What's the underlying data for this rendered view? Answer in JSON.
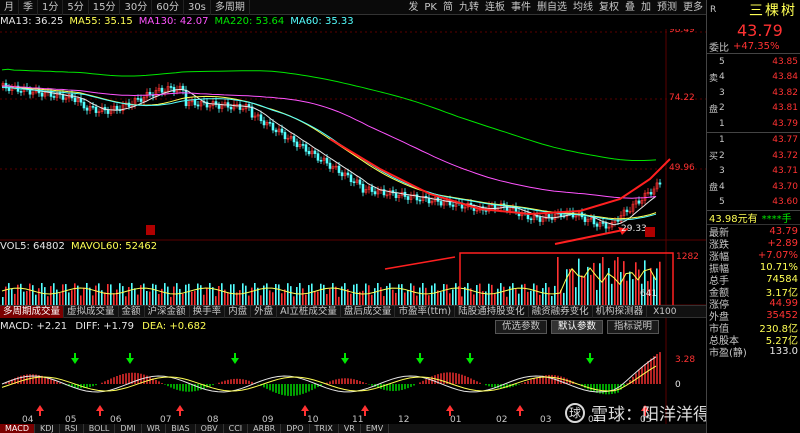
{
  "toolbar": {
    "periods": [
      "月",
      "季",
      "1分",
      "5分",
      "15分",
      "30分",
      "60分",
      "30s",
      "多周期"
    ],
    "tools": [
      "发",
      "PK",
      "简",
      "九转",
      "连板",
      "事件",
      "删自选",
      "均线",
      "复权",
      "叠",
      "加",
      "预测",
      "更多"
    ]
  },
  "ma_legend": [
    {
      "label": "MA13: 36.25",
      "color": "#e6e6e6"
    },
    {
      "label": "MA55: 35.15",
      "color": "#ffff54"
    },
    {
      "label": "MA130: 42.07",
      "color": "#ff54ff"
    },
    {
      "label": "MA220: 53.64",
      "color": "#00e600"
    },
    {
      "label": "MA60: 35.33",
      "color": "#54ffff"
    }
  ],
  "price_axis": [
    "98.49",
    "74.22",
    "49.96"
  ],
  "annotations": {
    "low_price": "29.33"
  },
  "vol_legend": {
    "vol5": "VOL5: 64802",
    "mavol60": "MAVOL60: 52462"
  },
  "vol_axis": [
    "1282",
    "641",
    "X100"
  ],
  "tabs": [
    "多周期成交量",
    "虚拟成交量",
    "金额",
    "沪深金额",
    "换手率",
    "内盘",
    "外盘",
    "AI立桩成交量",
    "盘后成交量",
    "市盈率(ttm)",
    "陆股通持股变化",
    "融资融券变化",
    "机构探测器"
  ],
  "buttons": [
    "优选参数",
    "默认参数",
    "指标说明"
  ],
  "macd_legend": {
    "macd": "MACD: +2.21",
    "diff": "DIFF: +1.79",
    "dea": "DEA: +0.682"
  },
  "macd_axis": [
    "3.28",
    "0"
  ],
  "x_axis": [
    "04",
    "05",
    "06",
    "07",
    "08",
    "09",
    "10",
    "11",
    "12",
    "01",
    "02",
    "03",
    "04",
    "05"
  ],
  "bottom_tabs": [
    "MACD",
    "KDJ",
    "RSI",
    "BOLL",
    "DMI",
    "WR",
    "BIAS",
    "OBV",
    "CCI",
    "ARBR",
    "DPO",
    "TRIX",
    "VR",
    "EMV"
  ],
  "quote": {
    "code": "R",
    "name": "三棵树",
    "price": "43.79",
    "ratio_label": "委比",
    "ratio_value": "+47.35%",
    "sell": [
      {
        "lvl": "5",
        "price": "43.85"
      },
      {
        "lvl": "4",
        "price": "43.84"
      },
      {
        "lvl": "3",
        "price": "43.82"
      },
      {
        "lvl": "2",
        "price": "43.81"
      },
      {
        "lvl": "1",
        "price": "43.79"
      }
    ],
    "sell_labels": [
      "卖",
      "盘"
    ],
    "buy": [
      {
        "lvl": "1",
        "price": "43.77"
      },
      {
        "lvl": "2",
        "price": "43.72"
      },
      {
        "lvl": "3",
        "price": "43.71"
      },
      {
        "lvl": "4",
        "price": "43.70"
      },
      {
        "lvl": "5",
        "price": "43.60"
      }
    ],
    "buy_labels": [
      "买",
      "盘"
    ],
    "info_a": "43.98元有",
    "info_b": "****手",
    "stats": [
      {
        "k": "最新",
        "v": "43.79",
        "c": "up"
      },
      {
        "k": "涨跌",
        "v": "+2.89",
        "c": "up"
      },
      {
        "k": "涨幅",
        "v": "+7.07%",
        "c": "up"
      },
      {
        "k": "振幅",
        "v": "10.71%",
        "c": "yellow"
      },
      {
        "k": "总手",
        "v": "74584",
        "c": "yellow"
      },
      {
        "k": "金额",
        "v": "3.17亿",
        "c": "yellow"
      },
      {
        "k": "涨停",
        "v": "44.99",
        "c": "up"
      },
      {
        "k": "外盘",
        "v": "35452",
        "c": "up"
      },
      {
        "k": "市值",
        "v": "230.8亿",
        "c": "yellow"
      },
      {
        "k": "总股本",
        "v": "5.27亿",
        "c": "yellow"
      },
      {
        "k": "市盈(静)",
        "v": "133.0",
        "c": "white"
      }
    ]
  },
  "watermark": "雪球：阳洋洋得意",
  "watermark_logo": "球",
  "colors": {
    "up": "#ff3232",
    "down": "#54ffff",
    "accent": "#ffff54"
  }
}
